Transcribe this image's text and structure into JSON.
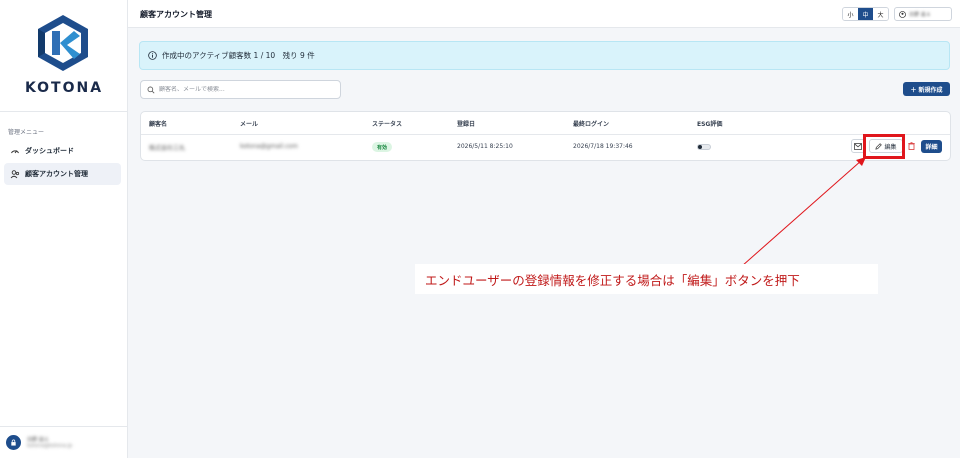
{
  "colors": {
    "brand": "#1e4d8c",
    "banner_bg": "#d9f3fb",
    "status_ok_bg": "#dcf5e3",
    "status_ok_text": "#1f8a45",
    "annotation": "#e0161c"
  },
  "sidebar": {
    "logo_text": "KOTONA",
    "menu_heading": "管理メニュー",
    "items": [
      {
        "label": "ダッシュボード",
        "icon": "speedometer-icon",
        "active": false
      },
      {
        "label": "顧客アカウント管理",
        "icon": "users-icon",
        "active": true
      }
    ],
    "user": {
      "avatar_icon": "lock-icon",
      "name": "日野 遥斗",
      "email": "kotona@kotona.jp"
    }
  },
  "header": {
    "title": "顧客アカウント管理",
    "font_sizes": [
      {
        "label": "小",
        "selected": false
      },
      {
        "label": "中",
        "selected": true
      },
      {
        "label": "大",
        "selected": false
      }
    ],
    "user_name": "日野 遥斗"
  },
  "banner": {
    "icon": "info-icon",
    "text": "作成中のアクティブ顧客数 1 / 10　残り 9 件"
  },
  "search": {
    "placeholder": "顧客名、メールで検索..."
  },
  "toolbar": {
    "new_label": "＋ 新規作成"
  },
  "table": {
    "columns": [
      "顧客名",
      "メール",
      "ステータス",
      "登録日",
      "最終ログイン",
      "ESG評価"
    ],
    "rows": [
      {
        "name": "株式会社三丸",
        "email": "kotona@gmail.com",
        "status": "有効",
        "registered": "2026/5/11 8:25:10",
        "last_login": "2026/7/18 19:37:46",
        "esg_enabled": false,
        "actions": {
          "edit_label": "編集",
          "detail_label": "詳細"
        }
      }
    ]
  },
  "annotation": {
    "text": "エンドユーザーの登録情報を修正する場合は「編集」ボタンを押下"
  }
}
